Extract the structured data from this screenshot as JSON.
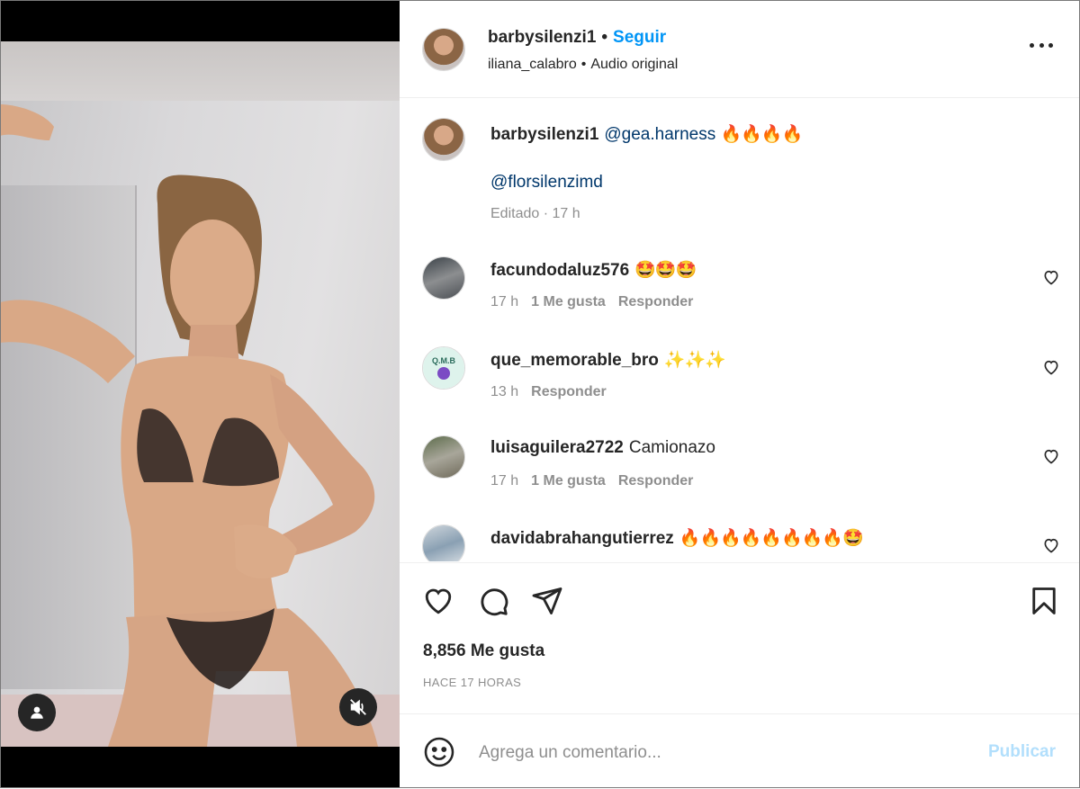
{
  "header": {
    "username": "barbysilenzi1",
    "separator": "•",
    "follow_label": "Seguir",
    "audio_user": "iliana_calabro",
    "audio_label": "Audio original"
  },
  "caption": {
    "username": "barbysilenzi1",
    "mention1": "@gea.harness",
    "emojis": "🔥🔥🔥🔥",
    "mention2": "@florsilenzimd",
    "edited": "Editado · 17 h"
  },
  "comments": [
    {
      "username": "facundodaluz576",
      "text": "🤩🤩🤩",
      "time": "17 h",
      "likes": "1 Me gusta",
      "reply": "Responder"
    },
    {
      "username": "que_memorable_bro",
      "text": "✨✨✨",
      "time": "13 h",
      "likes": "",
      "reply": "Responder"
    },
    {
      "username": "luisaguilera2722",
      "text": "Camionazo",
      "time": "17 h",
      "likes": "1 Me gusta",
      "reply": "Responder"
    },
    {
      "username": "davidabrahangutierrez",
      "text": "🔥🔥🔥🔥🔥🔥🔥🔥🤩",
      "time": "",
      "likes": "",
      "reply": ""
    }
  ],
  "avatar_badges": {
    "que_memorable_bro": "Q.M.B"
  },
  "stats": {
    "likes": "8,856 Me gusta",
    "time_ago": "HACE 17 HORAS"
  },
  "composer": {
    "placeholder": "Agrega un comentario...",
    "publish_label": "Publicar"
  },
  "colors": {
    "link_blue": "#0095f6",
    "mention_blue": "#00376b",
    "publish_disabled": "#b2dffc",
    "muted_gray": "#8e8e8e",
    "text": "#262626"
  },
  "icons": {
    "media_tag": "user-tag-icon",
    "media_mute": "volume-muted-icon",
    "like": "heart-icon",
    "comment": "comment-bubble-icon",
    "share": "paper-plane-icon",
    "save": "bookmark-icon",
    "emoji": "smiley-icon",
    "more": "more-options-icon"
  }
}
